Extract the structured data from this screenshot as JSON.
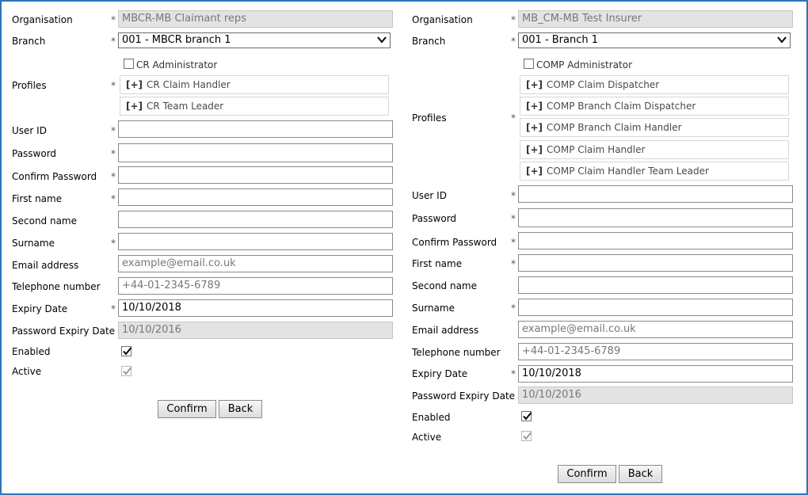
{
  "left": {
    "labels": {
      "organisation": "Organisation",
      "branch": "Branch",
      "profiles": "Profiles",
      "user_id": "User ID",
      "password": "Password",
      "confirm_password": "Confirm Password",
      "first_name": "First name",
      "second_name": "Second name",
      "surname": "Surname",
      "email": "Email address",
      "telephone": "Telephone number",
      "expiry_date": "Expiry Date",
      "password_expiry": "Password Expiry Date",
      "enabled": "Enabled",
      "active": "Active"
    },
    "required_mark": "*",
    "organisation_value": "MBCR-MB Claimant reps",
    "branch_value": "001 - MBCR branch 1",
    "admin_checkbox_label": "CR Administrator",
    "profiles": [
      {
        "plus": "[+]",
        "label": "CR Claim Handler"
      },
      {
        "plus": "[+]",
        "label": "CR Team Leader"
      }
    ],
    "user_id_value": "",
    "password_value": "",
    "confirm_password_value": "",
    "first_name_value": "",
    "second_name_value": "",
    "surname_value": "",
    "email_placeholder": "example@email.co.uk",
    "telephone_placeholder": "+44-01-2345-6789",
    "expiry_date_value": "10/10/2018",
    "password_expiry_value": "10/10/2016",
    "enabled_checked": true,
    "active_checked": true,
    "confirm_label": "Confirm",
    "back_label": "Back"
  },
  "right": {
    "labels": {
      "organisation": "Organisation",
      "branch": "Branch",
      "profiles": "Profiles",
      "user_id": "User ID",
      "password": "Password",
      "confirm_password": "Confirm Password",
      "first_name": "First name",
      "second_name": "Second name",
      "surname": "Surname",
      "email": "Email address",
      "telephone": "Telephone number",
      "expiry_date": "Expiry Date",
      "password_expiry": "Password Expiry Date",
      "enabled": "Enabled",
      "active": "Active"
    },
    "required_mark": "*",
    "organisation_value": "MB_CM-MB Test Insurer",
    "branch_value": "001 - Branch 1",
    "admin_checkbox_label": "COMP Administrator",
    "profiles": [
      {
        "plus": "[+]",
        "label": "COMP Claim Dispatcher"
      },
      {
        "plus": "[+]",
        "label": "COMP Branch Claim Dispatcher"
      },
      {
        "plus": "[+]",
        "label": "COMP Branch Claim Handler"
      },
      {
        "plus": "[+]",
        "label": "COMP Claim Handler"
      },
      {
        "plus": "[+]",
        "label": "COMP Claim Handler Team Leader"
      }
    ],
    "user_id_value": "",
    "password_value": "",
    "confirm_password_value": "",
    "first_name_value": "",
    "second_name_value": "",
    "surname_value": "",
    "email_placeholder": "example@email.co.uk",
    "telephone_placeholder": "+44-01-2345-6789",
    "expiry_date_value": "10/10/2018",
    "password_expiry_value": "10/10/2016",
    "enabled_checked": true,
    "active_checked": true,
    "confirm_label": "Confirm",
    "back_label": "Back"
  },
  "colors": {
    "frame_border": "#2b73b9",
    "readonly_bg": "#e3e3e3"
  }
}
